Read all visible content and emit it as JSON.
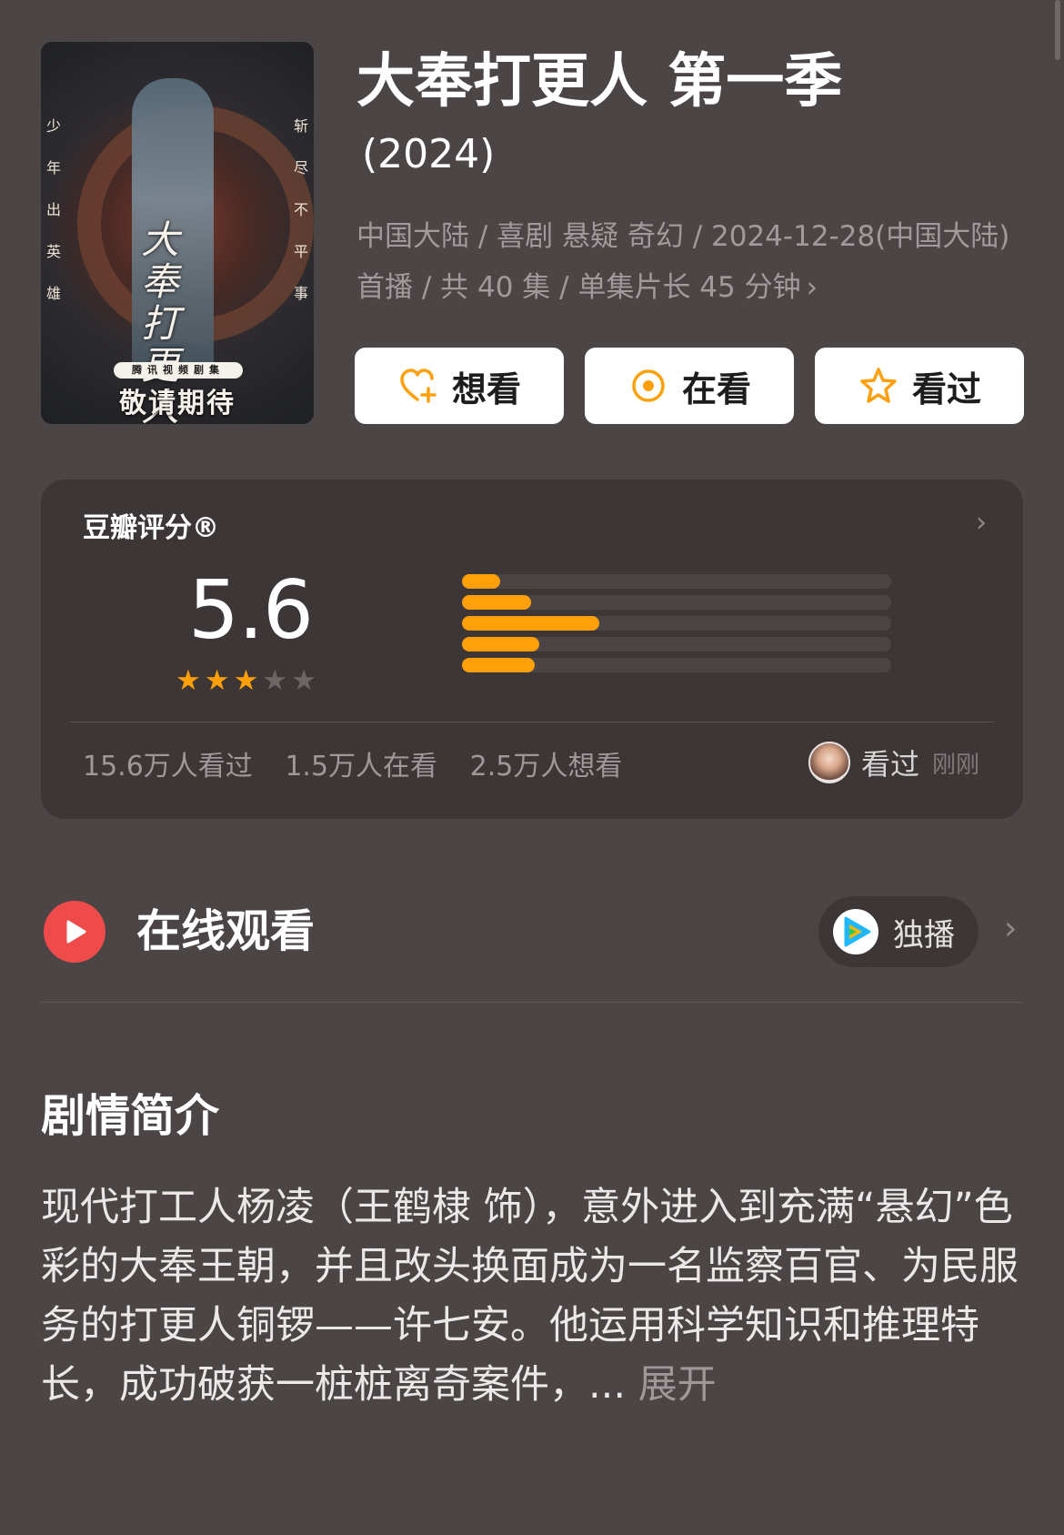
{
  "header": {
    "title": "大奉打更人 第一季",
    "year": "(2024)",
    "meta": "中国大陆 / 喜剧 悬疑 奇幻 / 2024-12-28(中国大陆) 首播 / 共 40 集 / 单集片长 45 分钟",
    "meta_chevron": "›"
  },
  "poster": {
    "left_vertical": "少年出英雄",
    "right_vertical": "斩尽不平事",
    "calligraphy": "大奉打更人",
    "tag": "腾讯视频剧集",
    "coming": "敬请期待"
  },
  "actions": [
    {
      "label": "想看",
      "icon": "heart-plus-icon"
    },
    {
      "label": "在看",
      "icon": "target-icon"
    },
    {
      "label": "看过",
      "icon": "star-outline-icon"
    }
  ],
  "rating": {
    "label": "豆瓣评分®",
    "score": "5.6",
    "stars_filled": 3,
    "stars_total": 5,
    "distribution": [
      {
        "stars": "★★★★★",
        "fraction": 0.09
      },
      {
        "stars": "★★★★",
        "fraction": 0.16
      },
      {
        "stars": "★★★",
        "fraction": 0.32
      },
      {
        "stars": "★★",
        "fraction": 0.18
      },
      {
        "stars": "★",
        "fraction": 0.17
      }
    ],
    "stats": [
      "15.6万人看过",
      "1.5万人在看",
      "2.5万人想看"
    ],
    "recent_label": "看过",
    "recent_time": "刚刚",
    "chevron": "›"
  },
  "online": {
    "title": "在线观看",
    "exclusive_label": "独播",
    "chevron": "›"
  },
  "synopsis": {
    "title": "剧情简介",
    "text": "现代打工人杨凌（王鹤棣 饰），意外进入到充满“悬幻”色彩的大奉王朝，并且改头换面成为一名监察百官、为民服务的打更人铜锣——许七安。他运用科学知识和推理特长，成功破获一桩桩离奇案件，",
    "ellipsis": "... ",
    "more": "展开"
  },
  "colors": {
    "background": "#4b4546",
    "card": "#3c3637",
    "accent_orange": "#ff9f0a",
    "play_red": "#f04b4b"
  }
}
